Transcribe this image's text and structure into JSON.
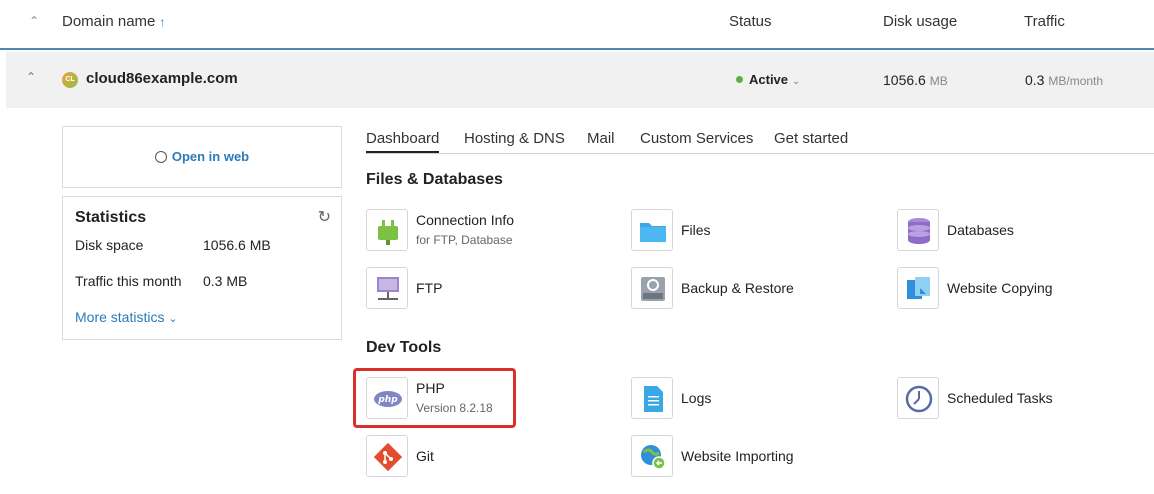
{
  "header": {
    "domain_col": "Domain name",
    "status_col": "Status",
    "disk_col": "Disk usage",
    "traffic_col": "Traffic"
  },
  "domain": {
    "favicon_text": "CL",
    "name": "cloud86example.com",
    "status": "Active",
    "disk_value": "1056.6",
    "disk_unit": "MB",
    "traffic_value": "0.3",
    "traffic_unit": "MB/month"
  },
  "left": {
    "open_in_web": "Open in web",
    "stats_title": "Statistics",
    "disk_label": "Disk space",
    "disk_value": "1056.6 MB",
    "traffic_label": "Traffic this month",
    "traffic_value": "0.3 MB",
    "more": "More statistics"
  },
  "tabs": [
    "Dashboard",
    "Hosting & DNS",
    "Mail",
    "Custom Services",
    "Get started"
  ],
  "sections": {
    "files": "Files & Databases",
    "dev": "Dev Tools"
  },
  "tiles": {
    "connection": {
      "title": "Connection Info",
      "sub": "for FTP, Database"
    },
    "files": {
      "title": "Files"
    },
    "databases": {
      "title": "Databases"
    },
    "ftp": {
      "title": "FTP"
    },
    "backup": {
      "title": "Backup & Restore"
    },
    "copying": {
      "title": "Website Copying"
    },
    "php": {
      "title": "PHP",
      "sub": "Version 8.2.18",
      "icon_text": "php"
    },
    "logs": {
      "title": "Logs"
    },
    "tasks": {
      "title": "Scheduled Tasks"
    },
    "git": {
      "title": "Git"
    },
    "importing": {
      "title": "Website Importing"
    }
  },
  "colors": {
    "accent": "#2b7bb9",
    "active_dot": "#5cb040",
    "highlight": "#d9302c"
  }
}
